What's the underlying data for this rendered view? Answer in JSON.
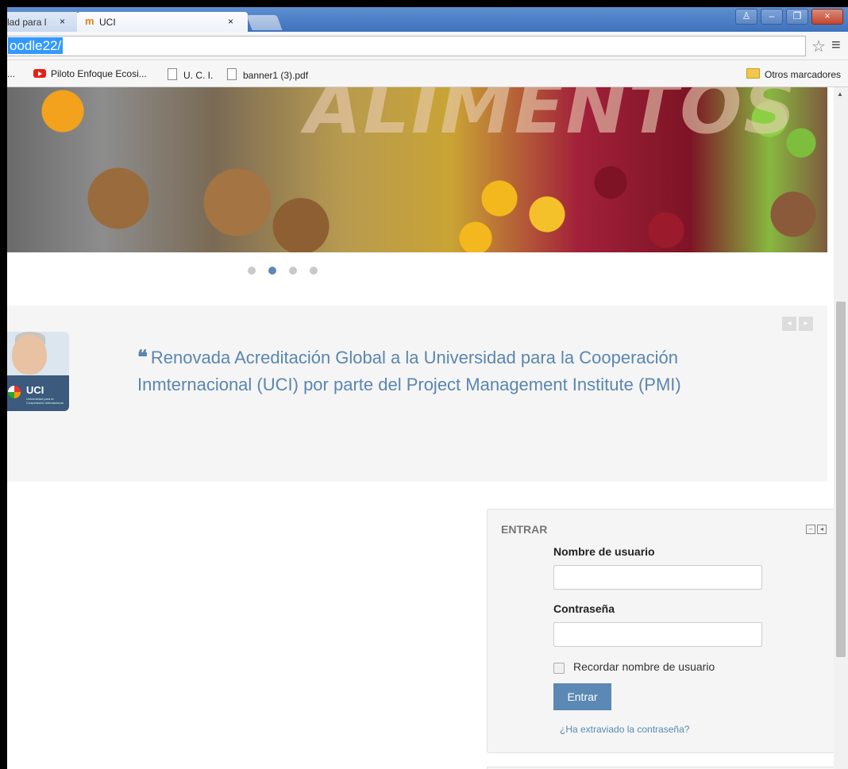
{
  "browser": {
    "tabs": [
      {
        "label": "lad para l",
        "close": "×"
      },
      {
        "label": "UCI",
        "close": "×",
        "favicon": "m"
      }
    ],
    "window_controls": [
      "♙",
      "–",
      "❐",
      "×"
    ],
    "url": "oodle22/",
    "star": "☆",
    "menu": "≡"
  },
  "bookmarks": {
    "items": [
      "...",
      "Piloto Enfoque Ecosi...",
      "U. C. I.",
      "banner1 (3).pdf"
    ],
    "other": "Otros marcadores"
  },
  "banner": {
    "text": "ALIMENTOS",
    "slide_count": 4,
    "active_slide": 2
  },
  "news": {
    "quote_mark": "❝",
    "headline": "Renovada Acreditación Global a la Universidad para la Cooperación Inmternacional (UCI) por parte del Project Management Institute (PMI)",
    "image_logo_text": "UCI",
    "image_logo_sub": "Universidad para la Cooperación Internacional",
    "prev": "◂",
    "next": "▸"
  },
  "login": {
    "title": "ENTRAR",
    "username_label": "Nombre de usuario",
    "username_value": "",
    "password_label": "Contraseña",
    "password_value": "",
    "remember_label": "Recordar nombre de usuario",
    "submit_label": "Entrar",
    "forgot_label": "¿Ha extraviado la contraseña?",
    "collapse": "–",
    "dock": "◂"
  },
  "colors": {
    "accent": "#5b88b5",
    "panel_bg": "#f5f5f5"
  }
}
